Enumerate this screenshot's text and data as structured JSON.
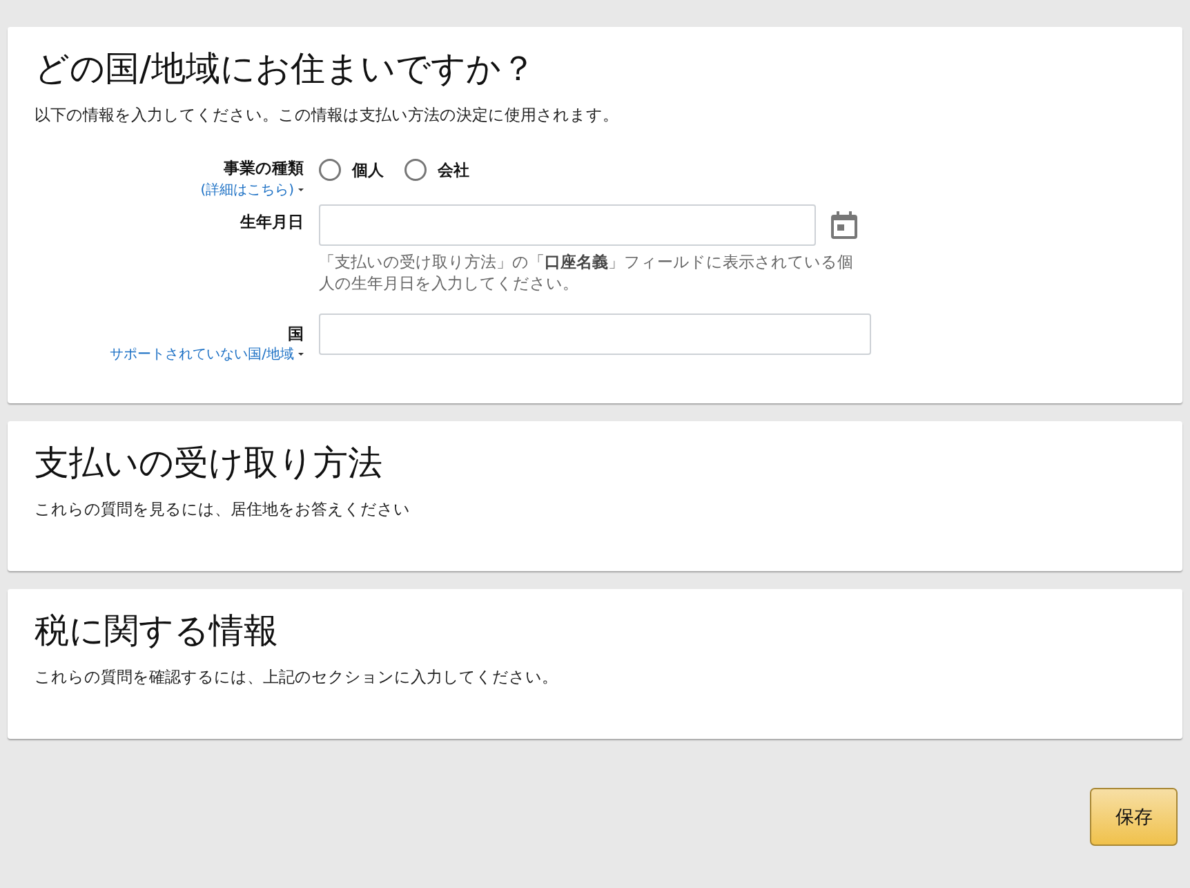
{
  "sections": [
    {
      "kind": "form",
      "title": "どの国/地域にお住まいですか？",
      "description": "以下の情報を入力してください。この情報は支払い方法の決定に使用されます。",
      "business_type": {
        "label": "事業の種類",
        "link": "(詳細はこちら)",
        "options": [
          {
            "label": "個人",
            "selected": false
          },
          {
            "label": "会社",
            "selected": false
          }
        ]
      },
      "birth_date": {
        "label": "生年月日",
        "hint": "「支払いの受け取り方法」の「**口座名義**」フィールドに表示されている個人の生年月日を入力してください。"
      },
      "country": {
        "label": "国",
        "link": "サポートされていない国/地域"
      }
    },
    {
      "kind": "info",
      "title": "支払いの受け取り方法",
      "description": "これらの質問を見るには、居住地をお答えください"
    },
    {
      "kind": "info",
      "title": "税に関する情報",
      "description": "これらの質問を確認するには、上記のセクションに入力してください。"
    }
  ],
  "save_button": "保存"
}
